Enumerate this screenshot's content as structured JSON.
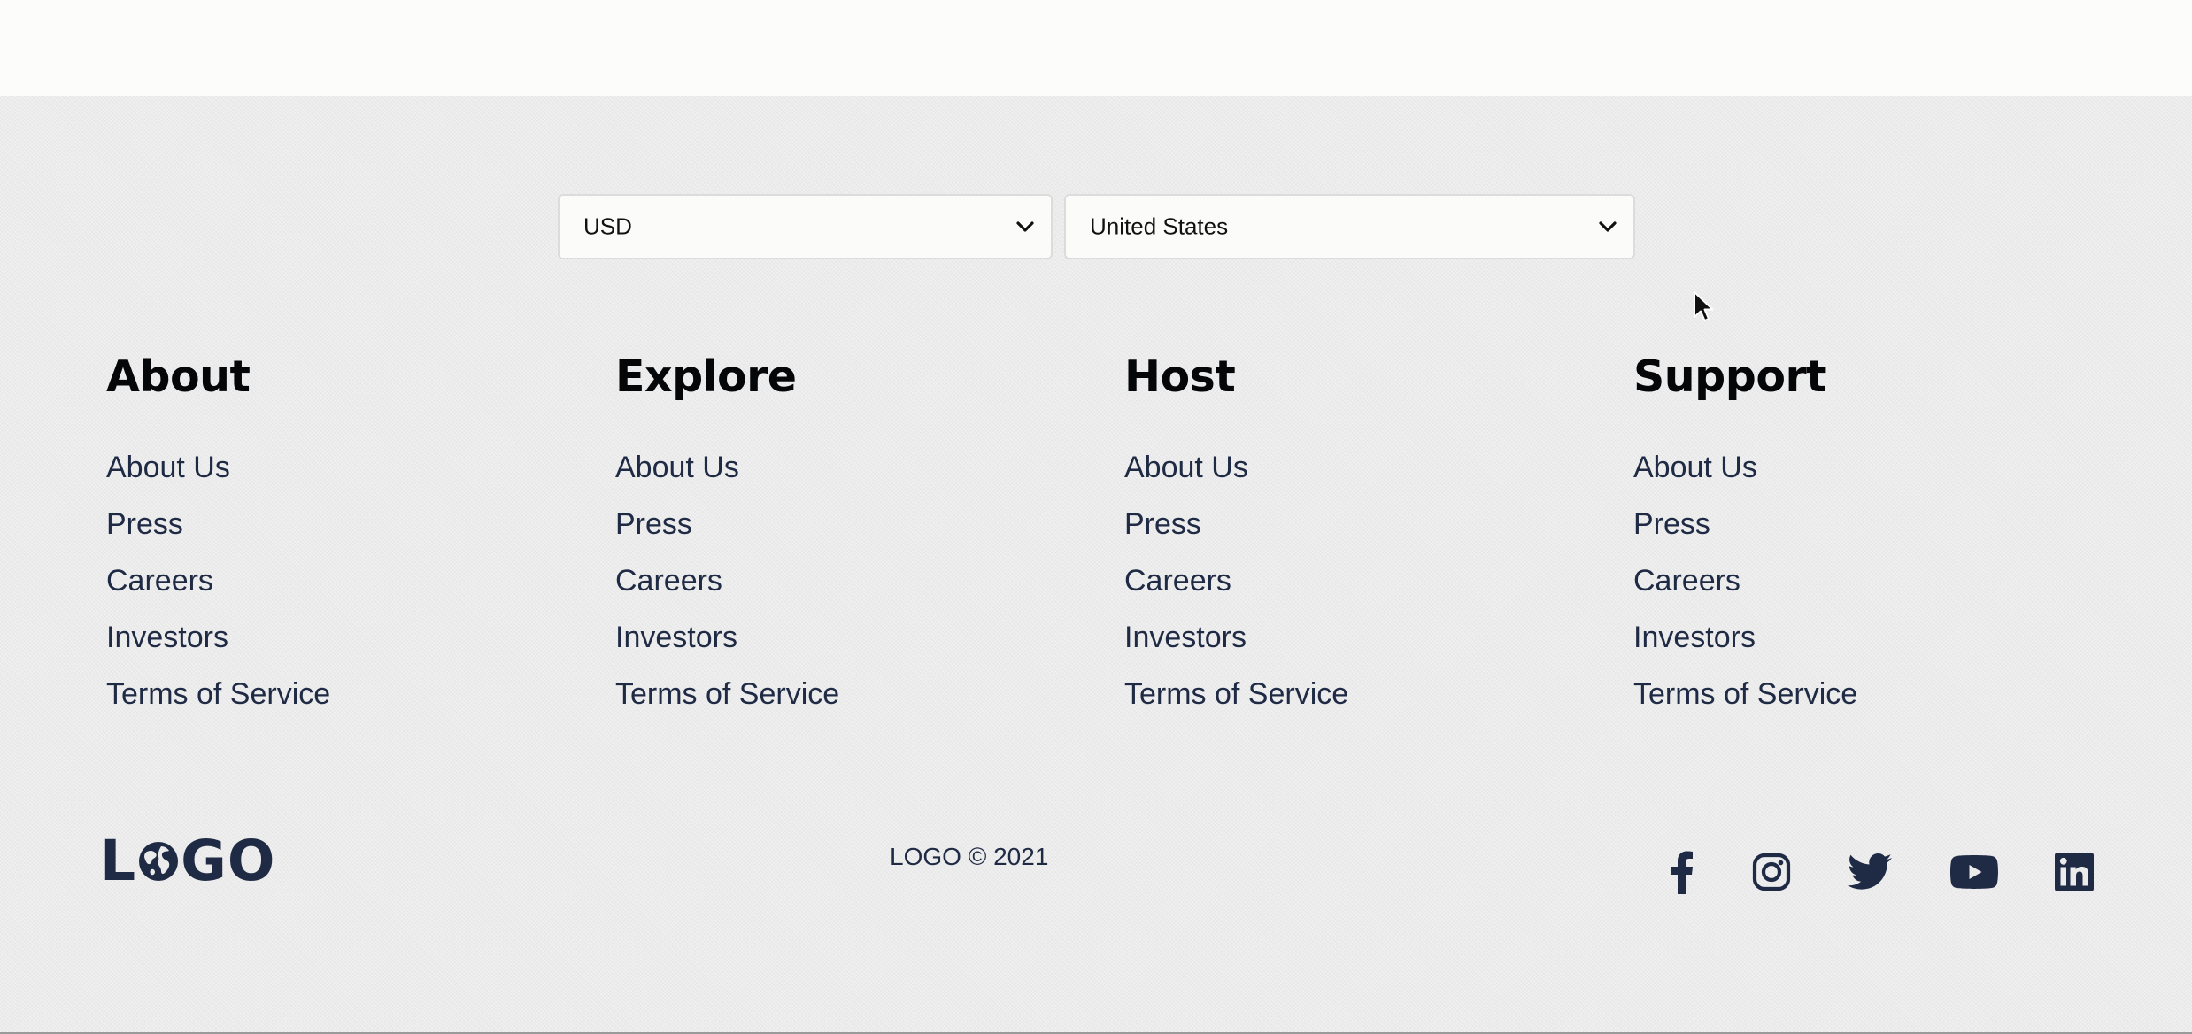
{
  "selectors": {
    "currency": {
      "value": "USD"
    },
    "country": {
      "value": "United States"
    }
  },
  "columns": [
    {
      "heading": "About",
      "links": [
        "About Us",
        "Press",
        "Careers",
        "Investors",
        "Terms of Service"
      ]
    },
    {
      "heading": "Explore",
      "links": [
        "About Us",
        "Press",
        "Careers",
        "Investors",
        "Terms of Service"
      ]
    },
    {
      "heading": "Host",
      "links": [
        "About Us",
        "Press",
        "Careers",
        "Investors",
        "Terms of Service"
      ]
    },
    {
      "heading": "Support",
      "links": [
        "About Us",
        "Press",
        "Careers",
        "Investors",
        "Terms of Service"
      ]
    }
  ],
  "logo": {
    "before": "L",
    "after": "GO"
  },
  "copyright": "LOGO © 2021",
  "social": [
    "facebook-icon",
    "instagram-icon",
    "twitter-icon",
    "youtube-icon",
    "linkedin-icon"
  ],
  "colors": {
    "text_dark": "#1f2a44",
    "heading": "#050608",
    "background": "#ebebeb"
  }
}
